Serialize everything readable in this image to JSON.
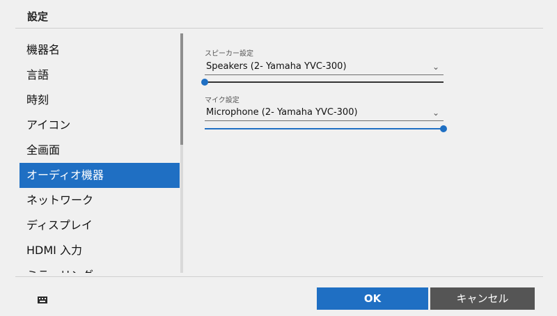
{
  "window": {
    "title": "設定"
  },
  "sidebar": {
    "items": [
      {
        "label": "機器名"
      },
      {
        "label": "言語"
      },
      {
        "label": "時刻"
      },
      {
        "label": "アイコン"
      },
      {
        "label": "全画面"
      },
      {
        "label": "オーディオ機器",
        "selected": true
      },
      {
        "label": "ネットワーク"
      },
      {
        "label": "ディスプレイ"
      },
      {
        "label": "HDMI 入力"
      },
      {
        "label": "ミラーリング"
      }
    ]
  },
  "audio": {
    "speaker": {
      "label": "スピーカー設定",
      "device": "Speakers (2- Yamaha YVC-300)",
      "volume_fraction": 0.0
    },
    "microphone": {
      "label": "マイク設定",
      "device": "Microphone (2- Yamaha YVC-300)",
      "volume_fraction": 1.0
    }
  },
  "footer": {
    "keyboard_icon": "keyboard-icon",
    "ok_label": "OK",
    "cancel_label": "キャンセル"
  },
  "colors": {
    "accent": "#1f6fc3",
    "cancel": "#555555",
    "background": "#f0f0f0"
  }
}
